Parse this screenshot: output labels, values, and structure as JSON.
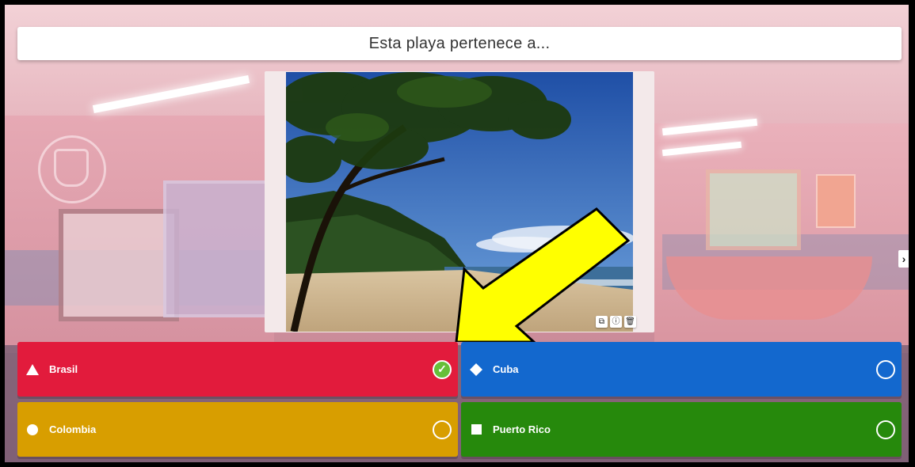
{
  "question": {
    "text": "Esta playa pertenece a..."
  },
  "media": {
    "image_alt": "beach photo",
    "tools": [
      {
        "icon": "crop-icon",
        "glyph": "⧉"
      },
      {
        "icon": "info-icon",
        "glyph": "ⓘ"
      },
      {
        "icon": "trash-icon",
        "glyph": "🗑"
      }
    ]
  },
  "navigation": {
    "next_glyph": "›"
  },
  "answers": [
    {
      "label": "Brasil",
      "color": "#e21b3c",
      "shape": "triangle",
      "correct": true,
      "check_glyph": "✓"
    },
    {
      "label": "Cuba",
      "color": "#1368ce",
      "shape": "diamond",
      "correct": false
    },
    {
      "label": "Colombia",
      "color": "#d89e00",
      "shape": "circle",
      "correct": false
    },
    {
      "label": "Puerto Rico",
      "color": "#26890c",
      "shape": "square",
      "correct": false
    }
  ],
  "annotation": {
    "arrow_color": "#ffff00"
  }
}
